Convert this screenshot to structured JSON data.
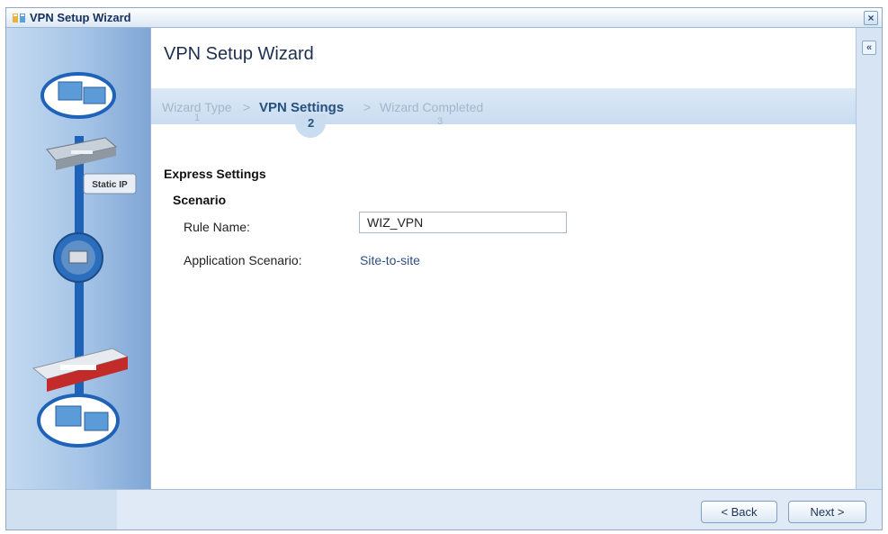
{
  "window": {
    "title": "VPN Setup Wizard",
    "close_glyph": "×",
    "collapse_glyph": "«"
  },
  "wizard": {
    "title": "VPN Setup Wizard",
    "steps": [
      {
        "label": "Wizard Type",
        "number": "1"
      },
      {
        "label": "VPN Settings",
        "number": "2"
      },
      {
        "label": "Wizard Completed",
        "number": "3"
      }
    ],
    "separator": ">"
  },
  "sidebar": {
    "static_ip_label": "Static IP"
  },
  "form": {
    "section_title": "Express Settings",
    "subsection_title": "Scenario",
    "rule_name_label": "Rule Name:",
    "rule_name_value": "WIZ_VPN",
    "application_scenario_label": "Application Scenario:",
    "application_scenario_value": "Site-to-site"
  },
  "footer": {
    "back_label": "< Back",
    "next_label": "Next >"
  },
  "colors": {
    "accent": "#25507f",
    "link": "#2d4f83",
    "sidebar": "#a4c3e6"
  }
}
